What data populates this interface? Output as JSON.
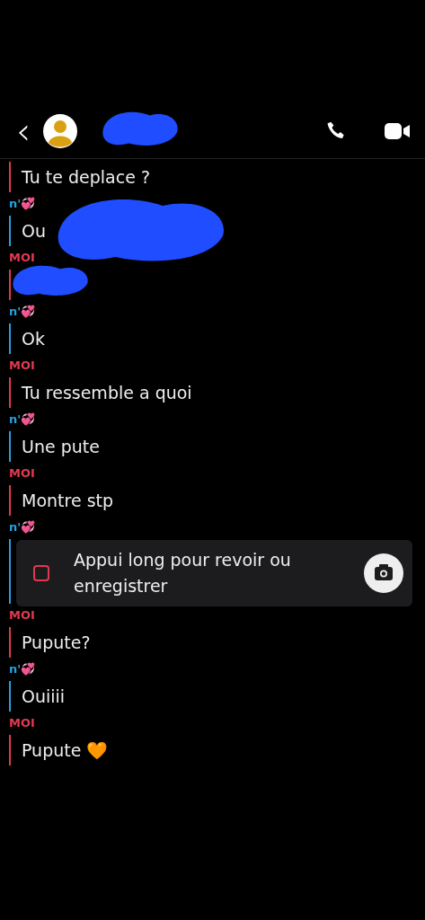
{
  "header": {
    "back": "‹"
  },
  "groups": [
    {
      "color": "#e0394f",
      "messages": [
        {
          "kind": "text",
          "text": "Tu te deplace ?"
        }
      ]
    },
    {
      "color": "#2a9fe0",
      "sender": "n'💞",
      "messages": [
        {
          "kind": "text",
          "text": "Ou"
        }
      ]
    },
    {
      "color": "#e0394f",
      "sender": "MOI",
      "messages": [
        {
          "kind": "hidden"
        }
      ]
    },
    {
      "color": "#2a9fe0",
      "sender": "n'💞",
      "messages": [
        {
          "kind": "text",
          "text": "Ok"
        }
      ]
    },
    {
      "color": "#e0394f",
      "sender": "MOI",
      "messages": [
        {
          "kind": "text",
          "text": "Tu ressemble a quoi"
        }
      ]
    },
    {
      "color": "#2a9fe0",
      "sender": "n'💞",
      "messages": [
        {
          "kind": "text",
          "text": "Une pute"
        }
      ]
    },
    {
      "color": "#e0394f",
      "sender": "MOI",
      "messages": [
        {
          "kind": "text",
          "text": "Montre stp"
        }
      ]
    },
    {
      "color": "#2a9fe0",
      "sender": "n'💞",
      "messages": [
        {
          "kind": "snap",
          "text": "Appui long pour revoir ou enregistrer"
        }
      ]
    },
    {
      "color": "#e0394f",
      "sender": "MOI",
      "messages": [
        {
          "kind": "text",
          "text": "Pupute?"
        }
      ]
    },
    {
      "color": "#2a9fe0",
      "sender": "n'💞",
      "messages": [
        {
          "kind": "text",
          "text": "Ouiiii"
        }
      ]
    },
    {
      "color": "#e0394f",
      "sender": "MOI",
      "messages": [
        {
          "kind": "text",
          "text": "Pupute 🧡"
        }
      ]
    }
  ]
}
